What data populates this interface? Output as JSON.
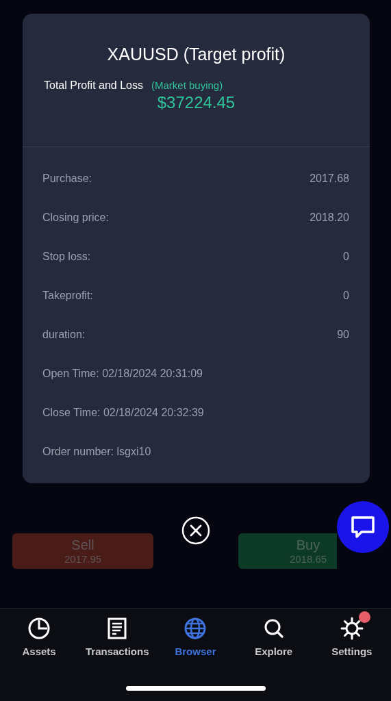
{
  "dialog": {
    "title": "XAUUSD (Target profit)",
    "pnl_label": "Total Profit and Loss",
    "order_type": "(Market buying)",
    "pnl_value": "$37224.45",
    "rows": [
      {
        "kind": "pair",
        "label": "Purchase:",
        "value": "2017.68"
      },
      {
        "kind": "pair",
        "label": "Closing price:",
        "value": "2018.20"
      },
      {
        "kind": "pair",
        "label": "Stop loss:",
        "value": "0"
      },
      {
        "kind": "pair",
        "label": "Takeprofit:",
        "value": "0"
      },
      {
        "kind": "pair",
        "label": "duration:",
        "value": "90"
      },
      {
        "kind": "text",
        "label": "Open Time: 02/18/2024 20:31:09"
      },
      {
        "kind": "text",
        "label": "Close Time: 02/18/2024 20:32:39"
      },
      {
        "kind": "text",
        "label": "Order number: lsgxi10"
      }
    ]
  },
  "trade_buttons": [
    {
      "kind": "sell",
      "label": "Sell",
      "price": "2017.95"
    },
    {
      "kind": "buy",
      "label": "Buy",
      "price": "2018.65"
    }
  ],
  "tab_bar": [
    {
      "kind": "assets",
      "label": "Assets",
      "selected": false,
      "badge": false
    },
    {
      "kind": "transactions",
      "label": "Transactions",
      "selected": false,
      "badge": false
    },
    {
      "kind": "browser",
      "label": "Browser",
      "selected": true,
      "badge": false
    },
    {
      "kind": "explore",
      "label": "Explore",
      "selected": false,
      "badge": false
    },
    {
      "kind": "settings",
      "label": "Settings",
      "selected": false,
      "badge": true
    }
  ]
}
